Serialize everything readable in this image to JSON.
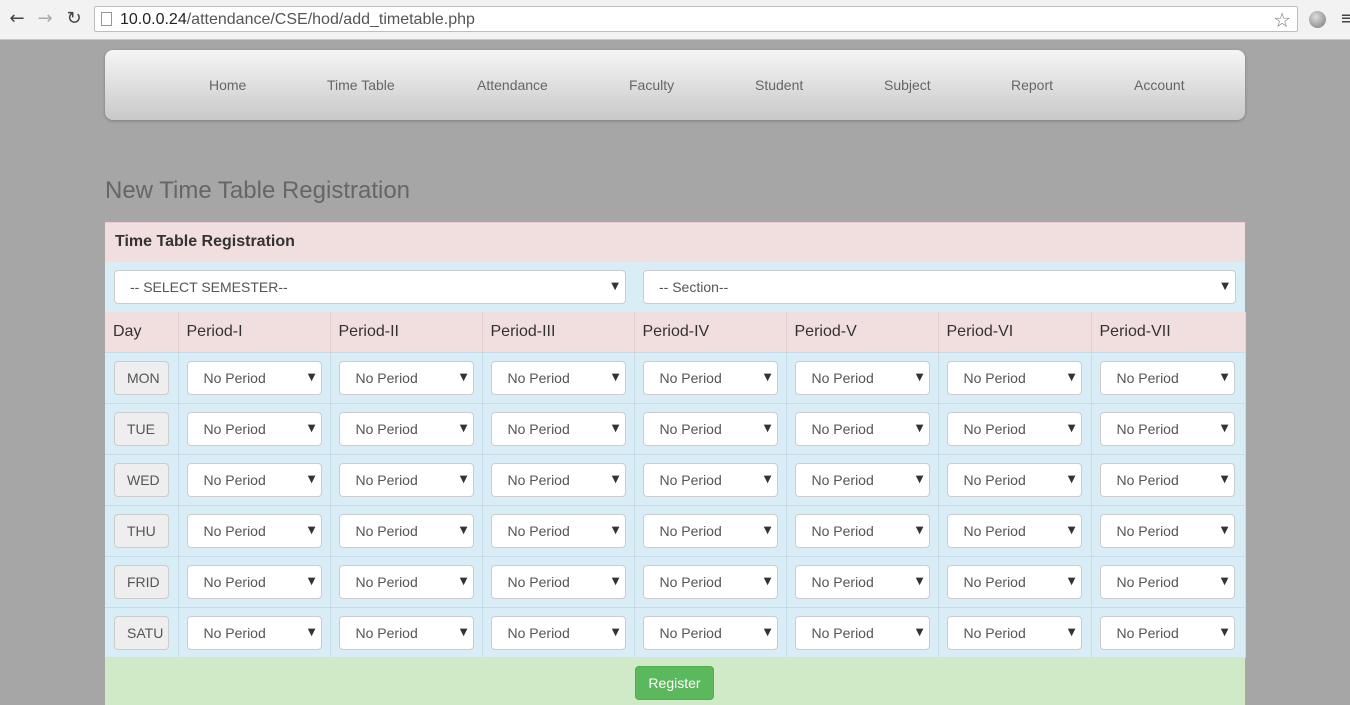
{
  "browser": {
    "url_host": "10.0.0.24",
    "url_path": "/attendance/CSE/hod/add_timetable.php"
  },
  "navbar": {
    "items": [
      "Home",
      "Time Table",
      "Attendance",
      "Faculty",
      "Student",
      "Subject",
      "Report",
      "Account"
    ]
  },
  "page_title": "New Time Table Registration",
  "panel": {
    "heading": "Time Table Registration",
    "semester_select": "-- SELECT SEMESTER--",
    "section_select": "-- Section--",
    "register_label": "Register"
  },
  "table": {
    "headers": [
      "Day",
      "Period-I",
      "Period-II",
      "Period-III",
      "Period-IV",
      "Period-V",
      "Period-VI",
      "Period-VII"
    ],
    "rows": [
      {
        "day": "MON",
        "periods": [
          "No Period",
          "No Period",
          "No Period",
          "No Period",
          "No Period",
          "No Period",
          "No Period"
        ]
      },
      {
        "day": "TUE",
        "periods": [
          "No Period",
          "No Period",
          "No Period",
          "No Period",
          "No Period",
          "No Period",
          "No Period"
        ]
      },
      {
        "day": "WED",
        "periods": [
          "No Period",
          "No Period",
          "No Period",
          "No Period",
          "No Period",
          "No Period",
          "No Period"
        ]
      },
      {
        "day": "THU",
        "periods": [
          "No Period",
          "No Period",
          "No Period",
          "No Period",
          "No Period",
          "No Period",
          "No Period"
        ]
      },
      {
        "day": "FRID",
        "periods": [
          "No Period",
          "No Period",
          "No Period",
          "No Period",
          "No Period",
          "No Period",
          "No Period"
        ]
      },
      {
        "day": "SATU",
        "periods": [
          "No Period",
          "No Period",
          "No Period",
          "No Period",
          "No Period",
          "No Period",
          "No Period"
        ]
      }
    ]
  }
}
